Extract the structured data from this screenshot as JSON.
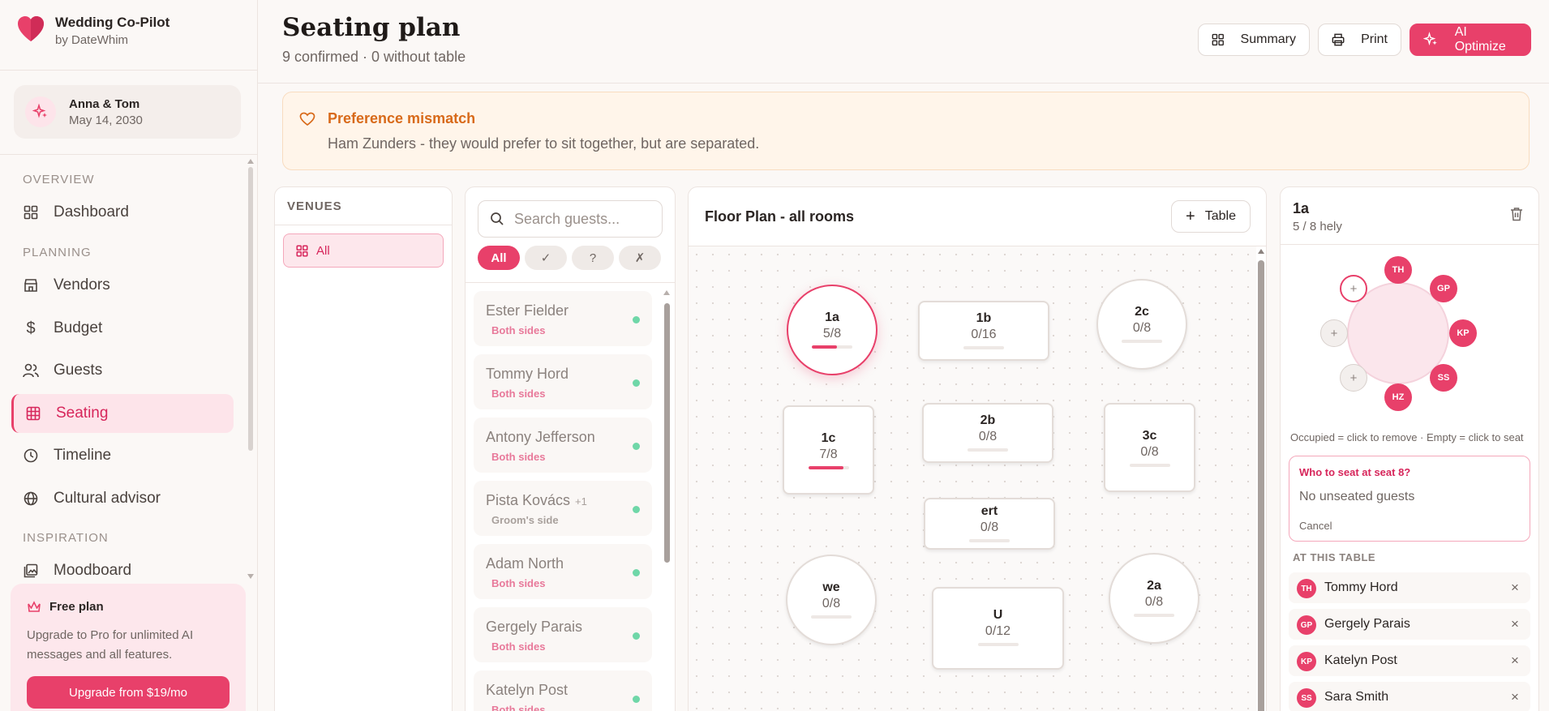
{
  "sidebar": {
    "brand_title": "Wedding Co-Pilot",
    "brand_sub": "by DateWhim",
    "couple_name": "Anna & Tom",
    "couple_date": "May 14, 2030",
    "sections": {
      "overview": "OVERVIEW",
      "planning": "PLANNING",
      "inspiration": "INSPIRATION"
    },
    "items": [
      {
        "label": "Dashboard",
        "icon": "grid-icon"
      },
      {
        "label": "Vendors",
        "icon": "store-icon"
      },
      {
        "label": "Budget",
        "icon": "dollar-icon"
      },
      {
        "label": "Guests",
        "icon": "users-icon"
      },
      {
        "label": "Seating",
        "icon": "table-grid-icon",
        "active": true
      },
      {
        "label": "Timeline",
        "icon": "clock-icon"
      },
      {
        "label": "Cultural advisor",
        "icon": "globe-icon"
      },
      {
        "label": "Moodboard",
        "icon": "image-icon"
      }
    ],
    "plan": {
      "title": "Free plan",
      "text": "Upgrade to Pro for unlimited AI messages and all features.",
      "button": "Upgrade from $19/mo"
    }
  },
  "header": {
    "title": "Seating plan",
    "subtitle": "9 confirmed · 0 without table",
    "buttons": {
      "summary": "Summary",
      "print": "Print",
      "optimize": "AI Optimize"
    }
  },
  "alert": {
    "title": "Preference mismatch",
    "text": "Ham Zunders - they would prefer to sit together, but are separated."
  },
  "venues": {
    "heading": "VENUES",
    "all": "All"
  },
  "guests": {
    "search_placeholder": "Search guests...",
    "filters": [
      "All",
      "✓",
      "?",
      "✗"
    ],
    "list": [
      {
        "name": "Ester Fielder",
        "extra": "",
        "side": "Both sides"
      },
      {
        "name": "Tommy Hord",
        "extra": "",
        "side": "Both sides"
      },
      {
        "name": "Antony Jefferson",
        "extra": "",
        "side": "Both sides"
      },
      {
        "name": "Pista Kovács",
        "extra": "+1",
        "side": "Groom's side"
      },
      {
        "name": "Adam North",
        "extra": "",
        "side": "Both sides"
      },
      {
        "name": "Gergely Parais",
        "extra": "",
        "side": "Both sides"
      },
      {
        "name": "Katelyn Post",
        "extra": "",
        "side": "Both sides"
      }
    ]
  },
  "floor": {
    "title": "Floor Plan - all rooms",
    "add_table": "Table",
    "tables": [
      {
        "name": "1a",
        "count": "5/8",
        "fill": 0.625
      },
      {
        "name": "1b",
        "count": "0/16",
        "fill": 0
      },
      {
        "name": "2c",
        "count": "0/8",
        "fill": 0
      },
      {
        "name": "1c",
        "count": "7/8",
        "fill": 0.875
      },
      {
        "name": "2b",
        "count": "0/8",
        "fill": 0
      },
      {
        "name": "3c",
        "count": "0/8",
        "fill": 0
      },
      {
        "name": "ert",
        "count": "0/8",
        "fill": 0
      },
      {
        "name": "we",
        "count": "0/8",
        "fill": 0
      },
      {
        "name": "2a",
        "count": "0/8",
        "fill": 0
      },
      {
        "name": "U",
        "count": "0/12",
        "fill": 0
      }
    ]
  },
  "detail": {
    "title": "1a",
    "subtitle": "5 / 8 hely",
    "seats": [
      {
        "label": "TH",
        "state": "occupied"
      },
      {
        "label": "GP",
        "state": "occupied"
      },
      {
        "label": "KP",
        "state": "occupied"
      },
      {
        "label": "SS",
        "state": "occupied"
      },
      {
        "label": "HZ",
        "state": "occupied"
      },
      {
        "label": "+",
        "state": "empty"
      },
      {
        "label": "+",
        "state": "empty"
      },
      {
        "label": "+",
        "state": "selected"
      }
    ],
    "hint": "Occupied = click to remove · Empty = click to seat",
    "who_title": "Who to seat at seat 8?",
    "who_empty": "No unseated guests",
    "cancel": "Cancel",
    "at_table_heading": "AT THIS TABLE",
    "at_table": [
      {
        "initials": "TH",
        "name": "Tommy Hord"
      },
      {
        "initials": "GP",
        "name": "Gergely Parais"
      },
      {
        "initials": "KP",
        "name": "Katelyn Post"
      },
      {
        "initials": "SS",
        "name": "Sara Smith"
      }
    ],
    "remove_symbol": "×"
  },
  "colors": {
    "accent": "#e8406a",
    "warning": "#d86a1a",
    "success": "#6fd7a8"
  }
}
